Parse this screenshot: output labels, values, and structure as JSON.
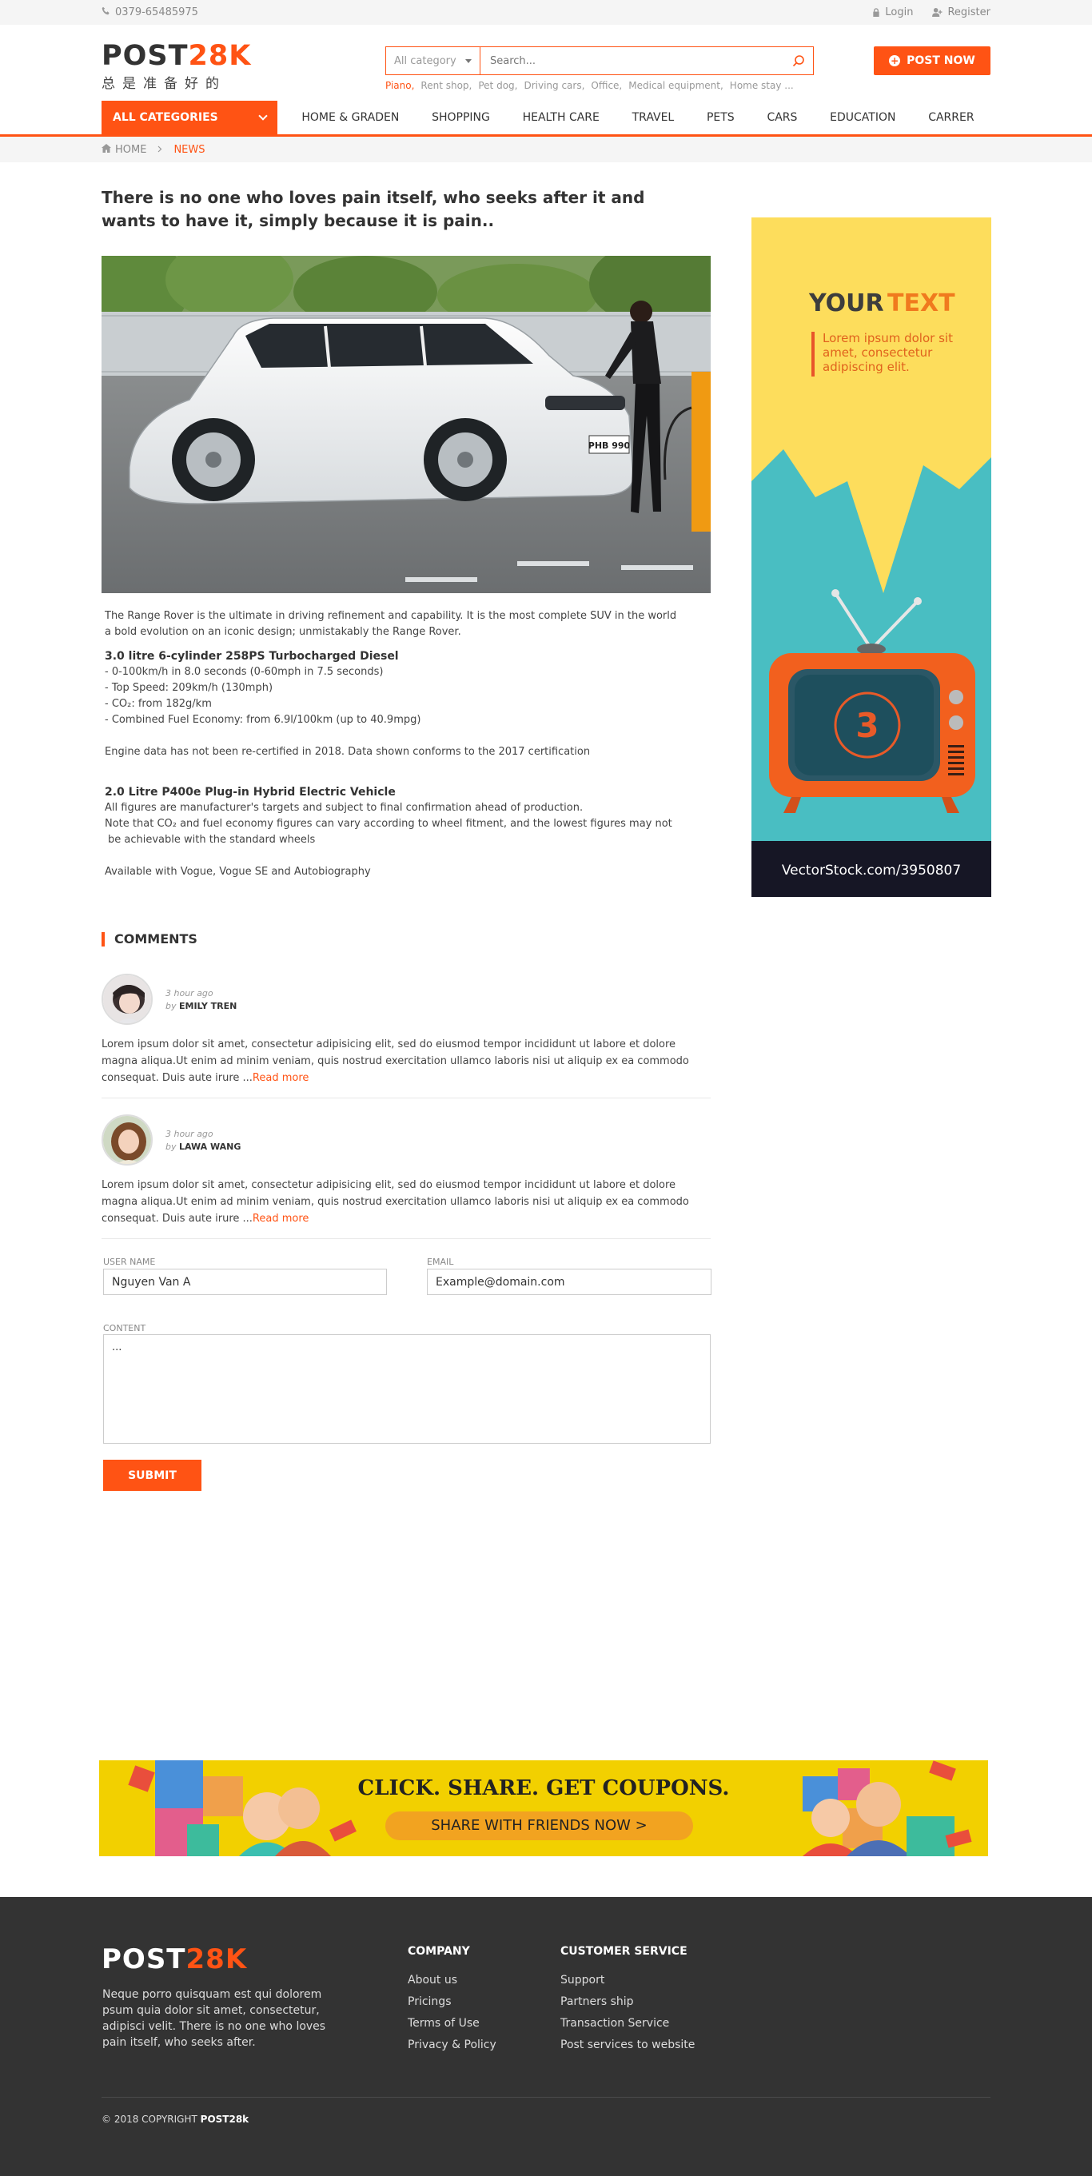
{
  "topbar": {
    "phone": "0379-65485975",
    "login": "Login",
    "register": "Register"
  },
  "header": {
    "logo_main": "POST",
    "logo_accent": "28K",
    "logo_tagline": "总是准备好的",
    "search_category": "All category",
    "search_placeholder": "Search...",
    "tags": [
      "Piano,",
      "Rent shop,",
      "Pet dog,",
      "Driving cars,",
      "Office,",
      "Medical equipment,",
      "Home stay ..."
    ],
    "post_now": "POST NOW"
  },
  "nav": {
    "all_categories": "ALL CATEGORIES",
    "items": [
      "HOME & GRADEN",
      "SHOPPING",
      "HEALTH CARE",
      "TRAVEL",
      "PETS",
      "CARS",
      "EDUCATION",
      "CARRER"
    ]
  },
  "breadcrumb": {
    "home": "HOME",
    "current": "NEWS"
  },
  "article": {
    "title": "There is no one who loves pain itself, who seeks after it and wants to have it, simply because it is pain..",
    "image_plate": "PHB 990",
    "intro": "The Range Rover is the ultimate in driving refinement and capability. It is the most complete SUV in the world a bold evolution on an iconic design; unmistakably the Range Rover.",
    "section1_title": "3.0 litre 6-cylinder 258PS Turbocharged Diesel",
    "specs": [
      "- 0-100km/h in 8.0 seconds (0-60mph in 7.5 seconds)",
      "- Top Speed: 209km/h (130mph)",
      "- CO₂: from 182g/km",
      "- Combined Fuel Economy: from 6.9l/100km (up to 40.9mpg)"
    ],
    "engine_note": "Engine data has not been re-certified in 2018. Data shown conforms to the 2017 certification",
    "section2_title": "2.0 Litre P400e Plug-in Hybrid Electric Vehicle",
    "section2_line1": "All figures are manufacturer's targets and subject to final confirmation ahead of production.",
    "section2_line2": "Note that CO₂ and fuel economy figures can vary according to wheel fitment, and the lowest figures may not",
    "section2_line3": "be achievable with the standard wheels",
    "availability": "Available with Vogue, Vogue SE and Autobiography"
  },
  "ad": {
    "headline_a": "YOUR",
    "headline_b": "TEXT",
    "body": [
      "Lorem ipsum dolor sit",
      "amet, consectetur",
      "adipiscing elit."
    ],
    "tv_number": "3",
    "footer": "VectorStock.com/3950807"
  },
  "comments": {
    "title": "COMMENTS",
    "items": [
      {
        "time": "3 hour ago",
        "by": "by",
        "author": "EMILY TREN",
        "text": "Lorem ipsum dolor sit amet, consectetur adipisicing elit, sed do eiusmod tempor incididunt ut labore et dolore magna aliqua.Ut enim ad minim veniam, quis nostrud exercitation ullamco laboris nisi ut aliquip ex ea commodo consequat. Duis aute irure ...",
        "more": "Read more"
      },
      {
        "time": "3 hour ago",
        "by": "by",
        "author": "LAWA WANG",
        "text": "Lorem ipsum dolor sit amet, consectetur adipisicing elit, sed do eiusmod tempor incididunt ut labore et dolore magna aliqua.Ut enim ad minim veniam, quis nostrud exercitation ullamco laboris nisi ut aliquip ex ea commodo consequat. Duis aute irure ...",
        "more": "Read more"
      }
    ]
  },
  "form": {
    "username_label": "USER NAME",
    "username_value": "Nguyen Van A",
    "email_label": "EMAIL",
    "email_value": "Example@domain.com",
    "content_label": "CONTENT",
    "content_value": "...",
    "submit": "SUBMIT"
  },
  "banner": {
    "headline": "CLICK. SHARE. GET COUPONS.",
    "button": "SHARE WITH FRIENDS NOW  >"
  },
  "footer": {
    "logo_main": "POST",
    "logo_accent": "28K",
    "description": "Neque porro quisquam est qui dolorem psum quia dolor sit amet, consectetur, adipisci velit. There is no one who loves pain itself, who seeks after.",
    "company_title": "COMPANY",
    "company_links": [
      "About us",
      "Pricings",
      "Terms of Use",
      "Privacy & Policy"
    ],
    "service_title": "CUSTOMER SERVICE",
    "service_links": [
      "Support",
      "Partners ship",
      "Transaction Service",
      "Post services to website"
    ],
    "copyright": "© 2018 COPYRIGHT",
    "copyright_brand": "POST28k"
  },
  "colors": {
    "accent": "#ff5314",
    "footer_bg": "#333333",
    "ad_yellow": "#fddd5c",
    "ad_teal": "#49bec2",
    "banner_yellow": "#f2d000"
  }
}
